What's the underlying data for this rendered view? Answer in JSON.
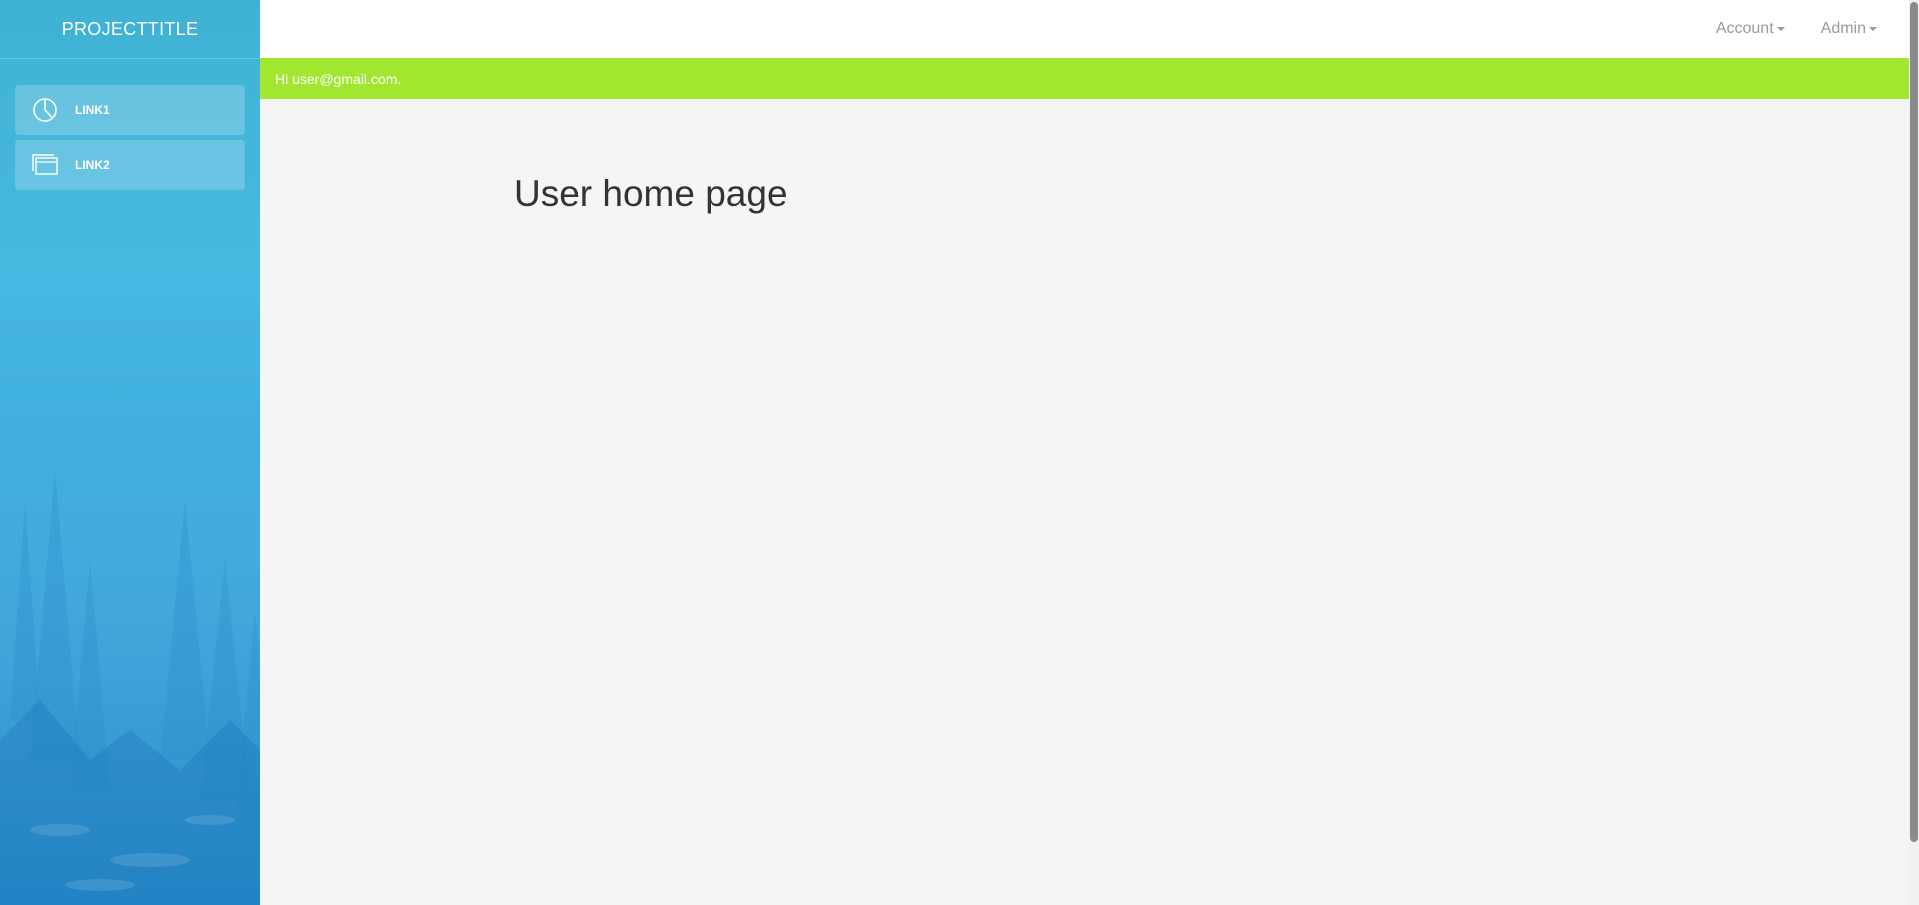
{
  "sidebar": {
    "brand": "PROJECTTITLE",
    "items": [
      {
        "label": "LINK1",
        "icon": "pie-chart-icon"
      },
      {
        "label": "LINK2",
        "icon": "windows-icon"
      }
    ]
  },
  "header": {
    "menus": [
      {
        "label": "Account"
      },
      {
        "label": "Admin"
      }
    ]
  },
  "greeting": {
    "text": "Hi user@gmail.com."
  },
  "main": {
    "title": "User home page"
  },
  "colors": {
    "sidebar_accent": "#36aee0",
    "greeting_bar": "#a1e72f",
    "background": "#f5f5f5"
  }
}
